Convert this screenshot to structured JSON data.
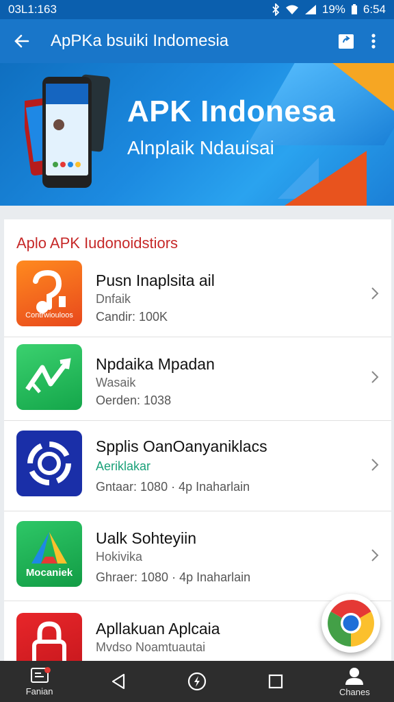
{
  "status_bar": {
    "time_left": "03L1:163",
    "battery": "19%",
    "clock": "6:54"
  },
  "app_bar": {
    "title": "ApPKa bsuiki Indomesia"
  },
  "banner": {
    "title": "APK Indonesa",
    "subtitle": "Alnplaik Ndauisai"
  },
  "section": {
    "title": "Aplo APK Iudonoidstiors"
  },
  "apps": [
    {
      "name": "Pusn Inaplsita ail",
      "category": "Dnfaik",
      "meta": "Candir: 100K",
      "icon_label": "Contrwiouloos",
      "icon": "music-app-icon"
    },
    {
      "name": "Npdaika Mpadan",
      "category": "Wasaik",
      "meta": "Oerden: 1038",
      "icon": "stock-chart-app-icon"
    },
    {
      "name": "Spplis OanOanyaniklacs",
      "category": "Aeriklakar",
      "meta": "Gntaar: 1080 · 4p Inaharlain",
      "icon": "ring-app-icon"
    },
    {
      "name": "Ualk Sohteyiin",
      "category": "Hokivika",
      "meta": "Ghraer: 1080 · 4p Inaharlain",
      "icon_label": "Mocaniek",
      "icon": "triangle-app-icon"
    },
    {
      "name": "Apllakuan Aplcaia",
      "category": "Mvdso Noamtuautai",
      "meta": "",
      "icon": "lock-app-icon"
    }
  ],
  "navbar": {
    "left_label": "Fanian",
    "right_label": "Chanes"
  },
  "colors": {
    "app_bar": "#1976c9",
    "status_bar": "#0b5fae",
    "accent_red": "#c62828",
    "nav": "#2d2d2d"
  }
}
